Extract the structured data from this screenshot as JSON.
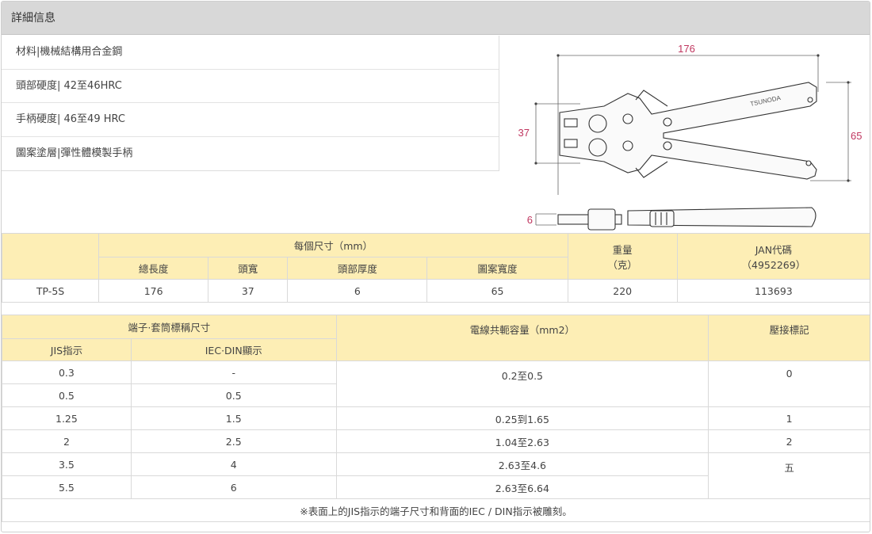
{
  "header": {
    "title": "詳細信息"
  },
  "specs": [
    "材料|機械結構用合金鋼",
    "頭部硬度| 42至46HRC",
    "手柄硬度| 46至49 HRC",
    "圖案塗層|彈性體模製手柄"
  ],
  "diagram": {
    "dim_length": "176",
    "dim_head_width": "37",
    "dim_handle_width": "65",
    "dim_thickness": "6",
    "brand": "TSUNODA"
  },
  "size_table": {
    "group_header": "每個尺寸（mm）",
    "col_length": "總長度",
    "col_head_width": "頭寬",
    "col_head_thickness": "頭部厚度",
    "col_pattern_width": "圖案寬度",
    "col_weight": "重量",
    "col_weight_unit": "（克）",
    "col_jan": "JAN代碼",
    "col_jan_code": "（4952269）",
    "row": {
      "model": "TP-5S",
      "length": "176",
      "head_width": "37",
      "head_thickness": "6",
      "pattern_width": "65",
      "weight": "220",
      "jan": "113693"
    }
  },
  "terminal_table": {
    "group_header": "端子·套筒標稱尺寸",
    "col_jis": "JIS指示",
    "col_iec": "IEC·DIN顯示",
    "col_wire": "電線共軛容量（mm2）",
    "col_mark": "壓接標記",
    "rows": [
      {
        "jis": "0.3",
        "iec": "-"
      },
      {
        "jis": "0.5",
        "iec": "0.5"
      },
      {
        "jis": "1.25",
        "iec": "1.5"
      },
      {
        "jis": "2",
        "iec": "2.5"
      },
      {
        "jis": "3.5",
        "iec": "4"
      },
      {
        "jis": "5.5",
        "iec": "6"
      }
    ],
    "wire_values": [
      "0.2至0.5",
      "0.25到1.65",
      "1.04至2.63",
      "2.63至4.6",
      "2.63至6.64"
    ],
    "mark_values": [
      "0",
      "1",
      "2",
      "五"
    ],
    "note": "※表面上的JIS指示的端子尺寸和背面的IEC / DIN指示被雕刻。"
  }
}
